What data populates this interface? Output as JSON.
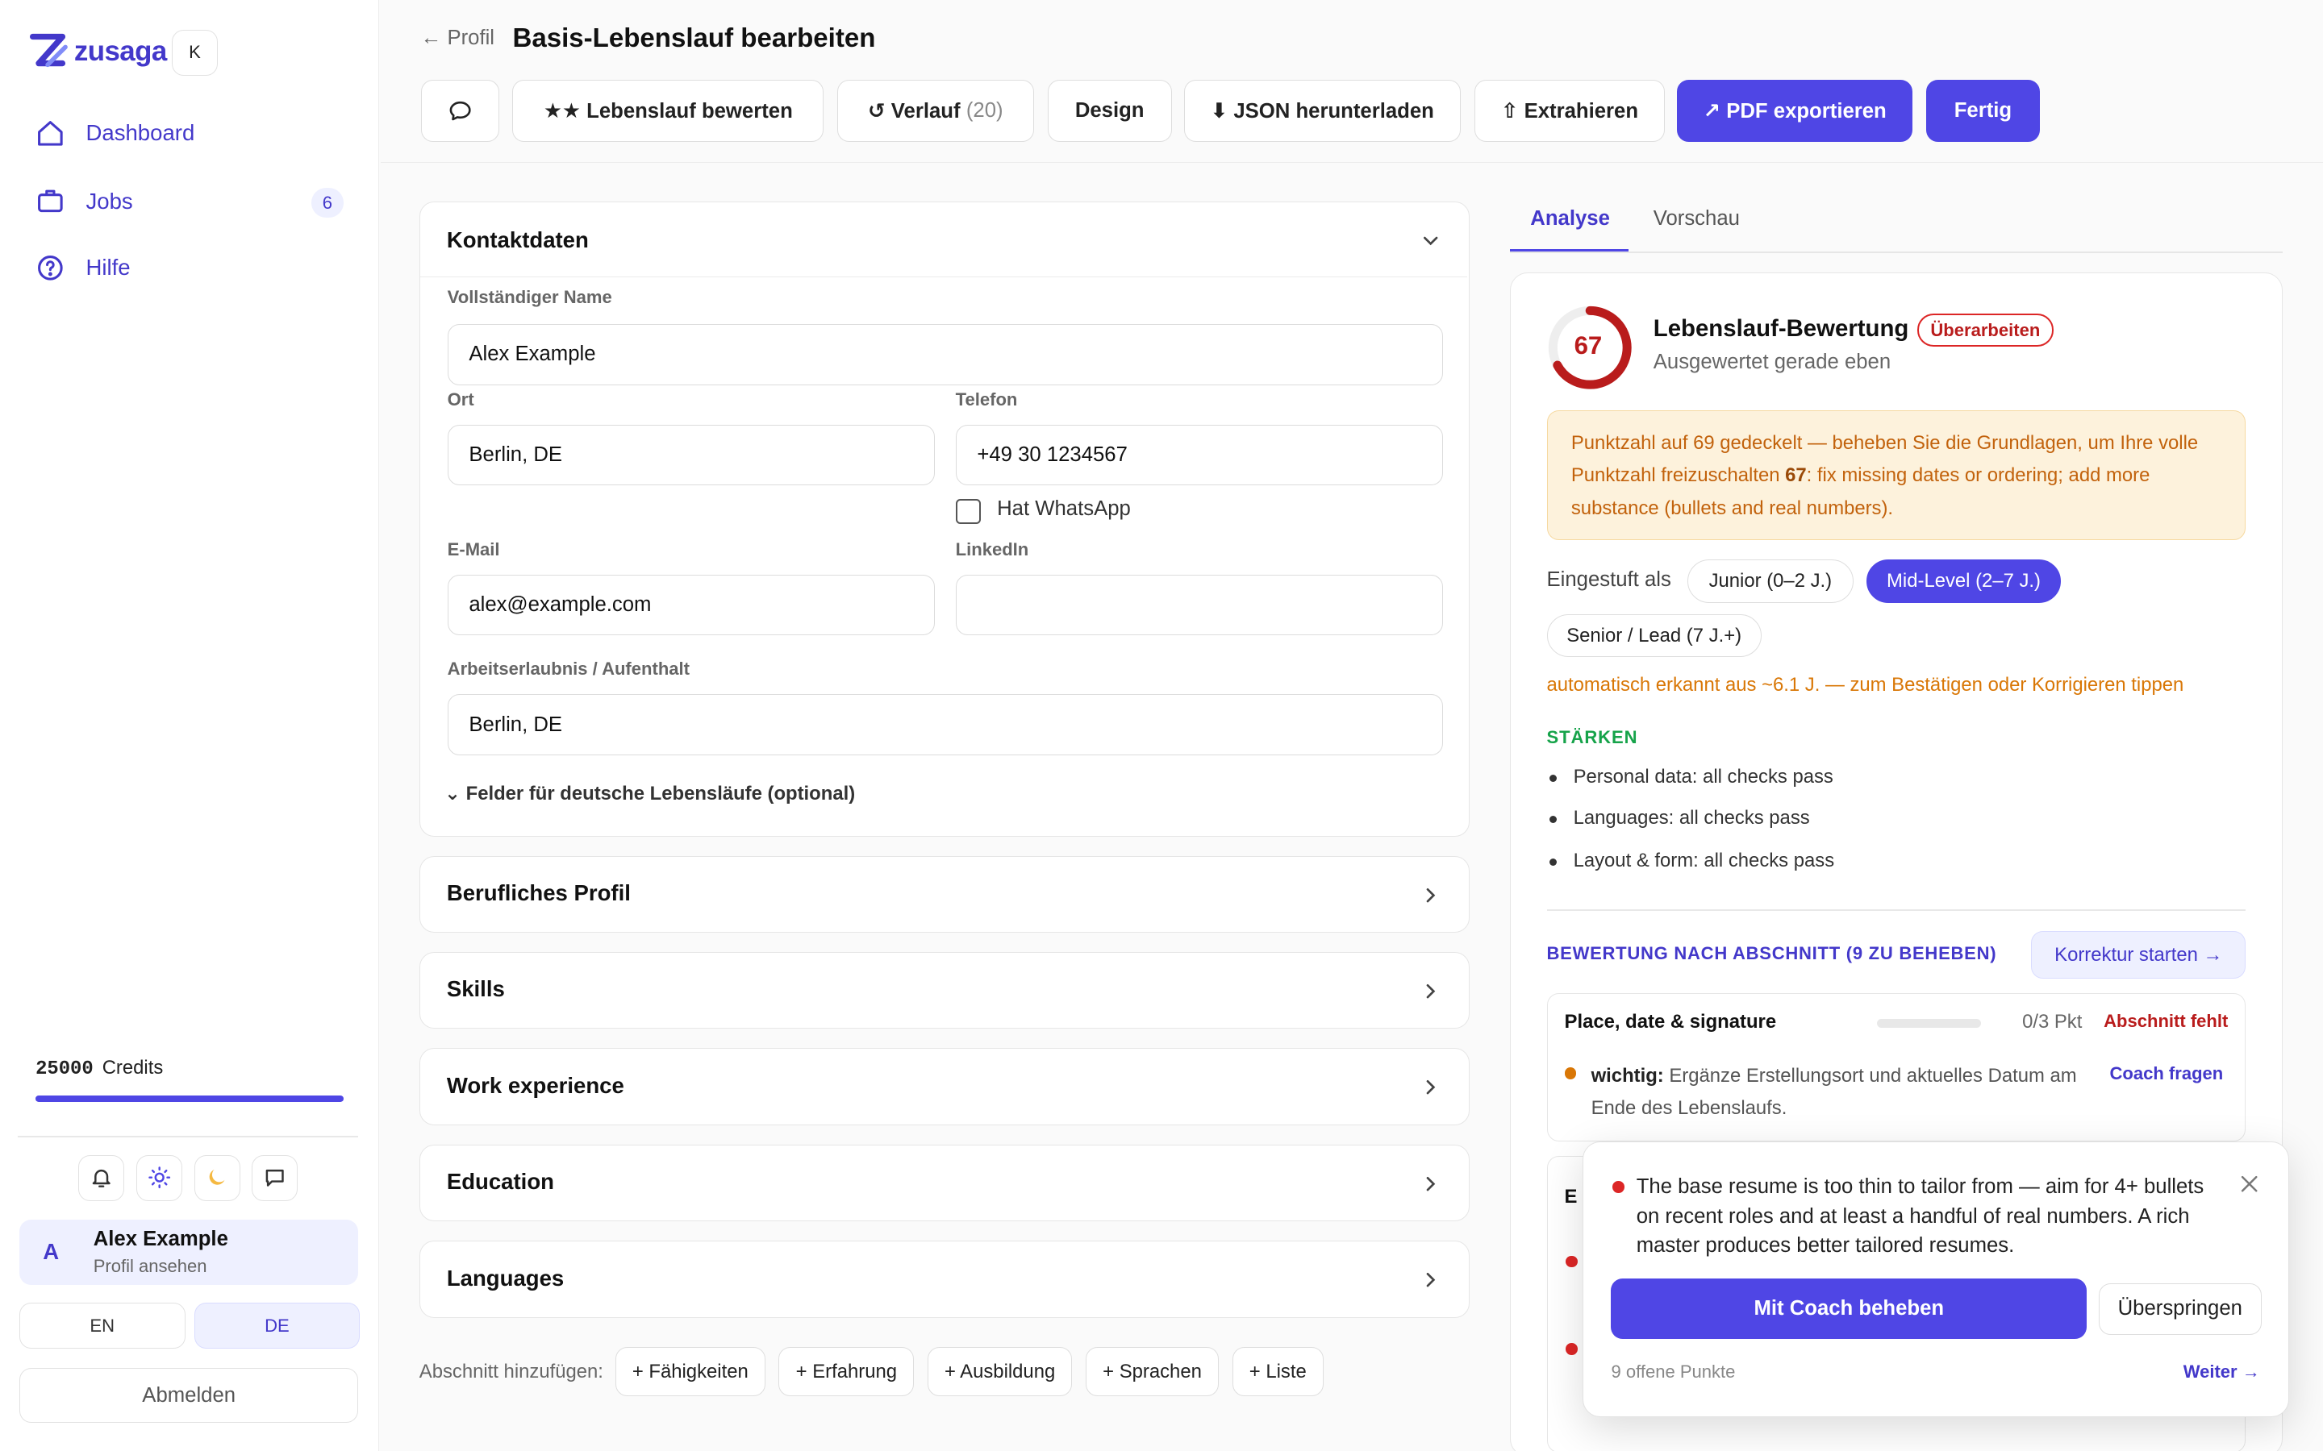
{
  "brand": {
    "name": "zusaga",
    "logo_color": "#4338ca",
    "collapse_label": "K"
  },
  "sidebar": {
    "nav": [
      {
        "label": "Dashboard",
        "icon": "home-icon"
      },
      {
        "label": "Jobs",
        "icon": "briefcase-icon",
        "badge": "6"
      },
      {
        "label": "Hilfe",
        "icon": "help-circle-icon"
      }
    ],
    "credits_value": "25000",
    "credits_label": "Credits",
    "credits_fill": 1.0,
    "icons": [
      "bell-icon",
      "sun-icon",
      "moon-icon",
      "chat-icon"
    ],
    "user": {
      "initial": "A",
      "name": "Alex Example",
      "sub": "Profil ansehen"
    },
    "languages": [
      {
        "label": "EN",
        "active": false
      },
      {
        "label": "DE",
        "active": true
      }
    ],
    "logout": "Abmelden"
  },
  "header": {
    "back": "← Profil",
    "title": "Basis-Lebenslauf bearbeiten",
    "toolbar": {
      "rate": "★★ Lebenslauf bewerten",
      "history": "↺ Verlauf",
      "history_count": "(20)",
      "design": "Design",
      "json": "⬇ JSON herunterladen",
      "extract": "⇧ Extrahieren",
      "pdf": "↗ PDF exportieren",
      "done": "Fertig"
    }
  },
  "contact": {
    "title": "Kontaktdaten",
    "name_label": "Vollständiger Name",
    "name_value": "Alex Example",
    "city_label": "Ort",
    "city_value": "Berlin, DE",
    "phone_label": "Telefon",
    "phone_value": "+49 30 1234567",
    "whatsapp_label": "Hat WhatsApp",
    "email_label": "E-Mail",
    "email_value": "alex@example.com",
    "linkedin_label": "LinkedIn",
    "linkedin_value": "",
    "permit_label": "Arbeitserlaubnis / Aufenthalt",
    "permit_value": "Berlin, DE",
    "german_toggle": "⌄ Felder für deutsche Lebensläufe (optional)"
  },
  "sections": [
    "Berufliches Profil",
    "Skills",
    "Work experience",
    "Education",
    "Languages"
  ],
  "add_section": {
    "label": "Abschnitt hinzufügen:",
    "chips": [
      "+ Fähigkeiten",
      "+ Erfahrung",
      "+ Ausbildung",
      "+ Sprachen",
      "+ Liste"
    ]
  },
  "tabs": {
    "analysis": "Analyse",
    "preview": "Vorschau"
  },
  "analysis": {
    "score": "67",
    "score_fraction": 0.67,
    "score_color": "#b91c1c",
    "title": "Lebenslauf-Bewertung",
    "badge": "Überarbeiten",
    "subtitle": "Ausgewertet gerade eben",
    "warning_pre": "Punktzahl auf 69 gedeckelt — beheben Sie die Grundlagen, um Ihre volle Punktzahl freizuschalten ",
    "warning_bold": "67",
    "warning_post": ": fix missing dates or ordering; add more substance (bullets and real numbers).",
    "level_label": "Eingestuft als",
    "levels": [
      {
        "label": "Junior (0–2 J.)",
        "active": false
      },
      {
        "label": "Mid-Level (2–7 J.)",
        "active": true
      },
      {
        "label": "Senior / Lead (7 J.+)",
        "active": false
      }
    ],
    "auto_note": "automatisch erkannt aus ~6.1 J. — zum Bestätigen oder Korrigieren tippen",
    "strengths_title": "STÄRKEN",
    "strengths": [
      "Personal data: all checks pass",
      "Languages: all checks pass",
      "Layout & form: all checks pass"
    ],
    "by_section_title": "BEWERTUNG NACH ABSCHNITT (9 ZU BEHEBEN)",
    "fix_button": "Korrektur starten →",
    "section_item": {
      "title": "Place, date & signature",
      "progress": 0.0,
      "points": "0/3 Pkt",
      "status": "Abschnitt fehlt",
      "tip_bold": "wichtig:",
      "tip_text": " Ergänze Erstellungsort und aktuelles Datum am Ende des Lebenslaufs.",
      "coach": "Coach fragen"
    },
    "next_section_initial": "E"
  },
  "popup": {
    "text": "The base resume is too thin to tailor from — aim for 4+ bullets on recent roles and at least a handful of real numbers. A rich master produces better tailored resumes.",
    "primary": "Mit Coach beheben",
    "skip": "Überspringen",
    "count": "9 offene Punkte",
    "next": "Weiter →"
  }
}
